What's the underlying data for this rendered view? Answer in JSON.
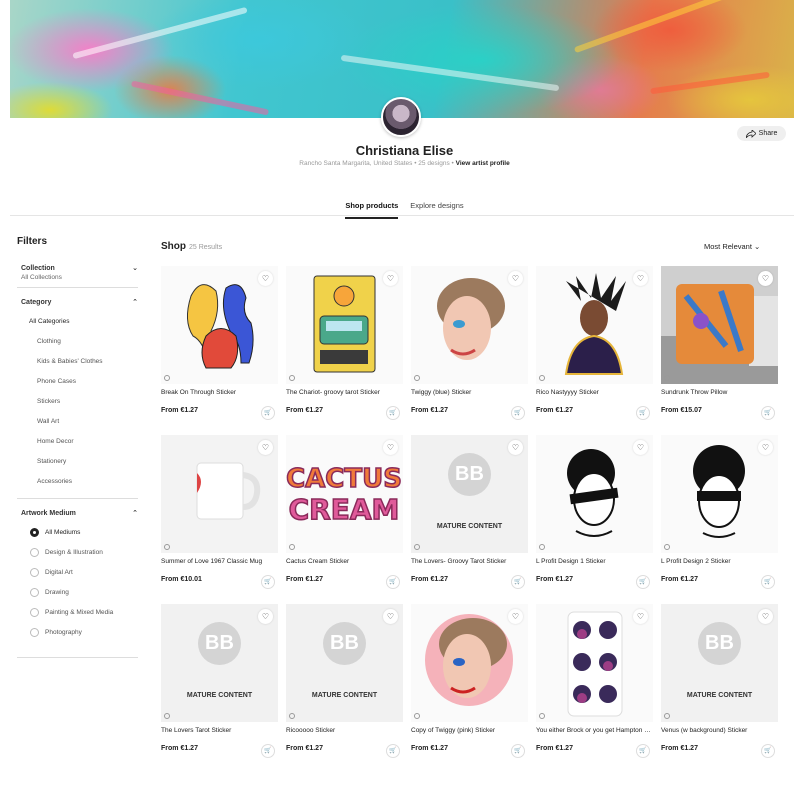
{
  "artist": {
    "name": "Christiana Elise",
    "location": "Rancho Santa Margarita, United States",
    "designs": "25 designs",
    "profile_link": "View artist profile",
    "share": "Share"
  },
  "tabs": [
    "Shop products",
    "Explore designs"
  ],
  "filters": {
    "title": "Filters",
    "collection": {
      "label": "Collection",
      "value": "All Collections"
    },
    "category": {
      "label": "Category",
      "items": [
        "All Categories",
        "Clothing",
        "Kids & Babies' Clothes",
        "Phone Cases",
        "Stickers",
        "Wall Art",
        "Home Decor",
        "Stationery",
        "Accessories"
      ]
    },
    "medium": {
      "label": "Artwork Medium",
      "items": [
        "All Mediums",
        "Design & Illustration",
        "Digital Art",
        "Drawing",
        "Painting & Mixed Media",
        "Photography"
      ]
    }
  },
  "shop": {
    "title": "Shop",
    "count": "25 Results",
    "sort": "Most Relevant"
  },
  "mature_label": "MATURE CONTENT",
  "products": [
    {
      "name": "Break On Through Sticker",
      "price": "From €1.27",
      "art": "sticker-figures"
    },
    {
      "name": "The Chariot- groovy tarot Sticker",
      "price": "From €1.27",
      "art": "tarot"
    },
    {
      "name": "Twiggy (blue) Sticker",
      "price": "From €1.27",
      "art": "portrait-blue"
    },
    {
      "name": "Rico Nastyyyy Sticker",
      "price": "From €1.27",
      "art": "rico"
    },
    {
      "name": "Sundrunk Throw Pillow",
      "price": "From €15.07",
      "art": "pillow"
    },
    {
      "name": "Summer of Love 1967 Classic Mug",
      "price": "From €10.01",
      "art": "mug"
    },
    {
      "name": "Cactus Cream Sticker",
      "price": "From €1.27",
      "art": "cactus"
    },
    {
      "name": "The Lovers- Groovy Tarot Sticker",
      "price": "From €1.27",
      "art": "mature"
    },
    {
      "name": "L Profit Design 1 Sticker",
      "price": "From €1.27",
      "art": "lprofit1"
    },
    {
      "name": "L Profit Design 2 Sticker",
      "price": "From €1.27",
      "art": "lprofit2"
    },
    {
      "name": "The Lovers Tarot Sticker",
      "price": "From €1.27",
      "art": "mature"
    },
    {
      "name": "Ricooooo Sticker",
      "price": "From €1.27",
      "art": "mature"
    },
    {
      "name": "Copy of Twiggy (pink) Sticker",
      "price": "From €1.27",
      "art": "portrait-pink"
    },
    {
      "name": "You either Brock or you get Hampton Sticker",
      "price": "From €1.27",
      "art": "faces"
    },
    {
      "name": "Venus (w background) Sticker",
      "price": "From €1.27",
      "art": "mature"
    }
  ],
  "icons": {
    "heart": "heart-outline-icon",
    "cart": "add-to-cart-icon",
    "share": "share-icon",
    "chevron": "chevron-icon"
  }
}
